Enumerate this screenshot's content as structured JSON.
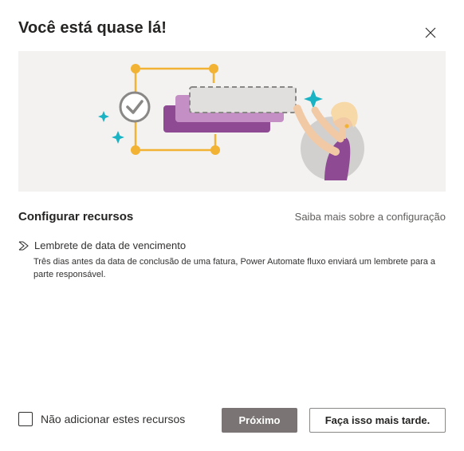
{
  "dialog": {
    "title": "Você está quase lá!",
    "close_icon": "close-icon"
  },
  "hero": {
    "illustration": "person-configuring-resources-illustration",
    "colors": {
      "background": "#f3f2f1",
      "frame": "#f2b233",
      "card_dark": "#8e4a93",
      "card_light": "#c48fc4",
      "sparkle": "#1ab3c4",
      "check": "#8a8886"
    }
  },
  "section": {
    "title": "Configurar recursos",
    "learn_more": "Saiba mais sobre a configuração"
  },
  "feature": {
    "icon": "flow-chevrons-icon",
    "name": "Lembrete de data de vencimento",
    "description": "Três dias antes da data de conclusão de uma fatura, Power Automate fluxo enviará um lembrete para a parte responsável."
  },
  "footer": {
    "checkbox_label": "Não adicionar estes recursos",
    "checkbox_checked": false,
    "primary_button": "Próximo",
    "secondary_button": "Faça isso mais tarde."
  }
}
